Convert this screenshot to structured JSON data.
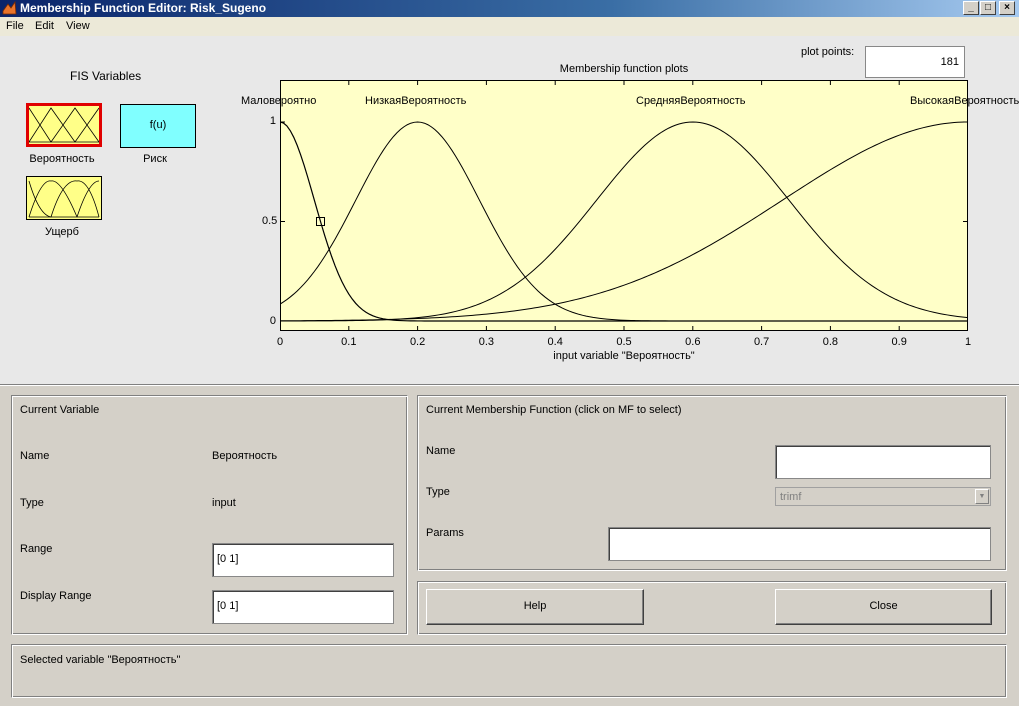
{
  "window": {
    "title": "Membership Function Editor: Risk_Sugeno",
    "minimize": "_",
    "maximize": "□",
    "close": "×"
  },
  "menu": [
    "File",
    "Edit",
    "View"
  ],
  "fis": {
    "title": "FIS Variables",
    "variables": [
      {
        "label": "Вероятность",
        "kind": "input",
        "selected": true
      },
      {
        "label": "Риск",
        "kind": "output",
        "text": "f(u)"
      },
      {
        "label": "Ущерб",
        "kind": "input"
      }
    ]
  },
  "plot_points": {
    "label": "plot points:",
    "value": "181"
  },
  "plot": {
    "title": "Membership function plots",
    "xlabel": "input variable \"Вероятность\"",
    "yticks": [
      "1",
      "0.5",
      "0"
    ],
    "xticks": [
      "0",
      "0.1",
      "0.2",
      "0.3",
      "0.4",
      "0.5",
      "0.6",
      "0.7",
      "0.8",
      "0.9",
      "1"
    ],
    "mf_labels": [
      "Маловероятно",
      "НизкаяВероятность",
      "СредняяВероятность",
      "ВысокаяВероятность"
    ]
  },
  "chart_data": {
    "type": "line",
    "title": "Membership function plots",
    "xlabel": "input variable \"Вероятность\"",
    "ylabel": "",
    "xlim": [
      0,
      1
    ],
    "ylim": [
      0,
      1
    ],
    "series": [
      {
        "name": "Маловероятно",
        "peak": 0.0,
        "sigma": 0.05
      },
      {
        "name": "НизкаяВероятность",
        "peak": 0.2,
        "sigma": 0.09
      },
      {
        "name": "СредняяВероятность",
        "peak": 0.6,
        "sigma": 0.14
      },
      {
        "name": "ВысокаяВероятность",
        "peak": 1.0,
        "sigma": 0.27
      }
    ]
  },
  "current_variable": {
    "header": "Current Variable",
    "name_label": "Name",
    "name_value": "Вероятность",
    "type_label": "Type",
    "type_value": "input",
    "range_label": "Range",
    "range_value": "[0 1]",
    "display_range_label": "Display Range",
    "display_range_value": "[0 1]"
  },
  "current_mf": {
    "header": "Current Membership Function (click on MF to select)",
    "name_label": "Name",
    "name_value": "",
    "type_label": "Type",
    "type_value": "trimf",
    "params_label": "Params",
    "params_value": ""
  },
  "buttons": {
    "help": "Help",
    "close": "Close"
  },
  "status": "Selected variable \"Вероятность\""
}
